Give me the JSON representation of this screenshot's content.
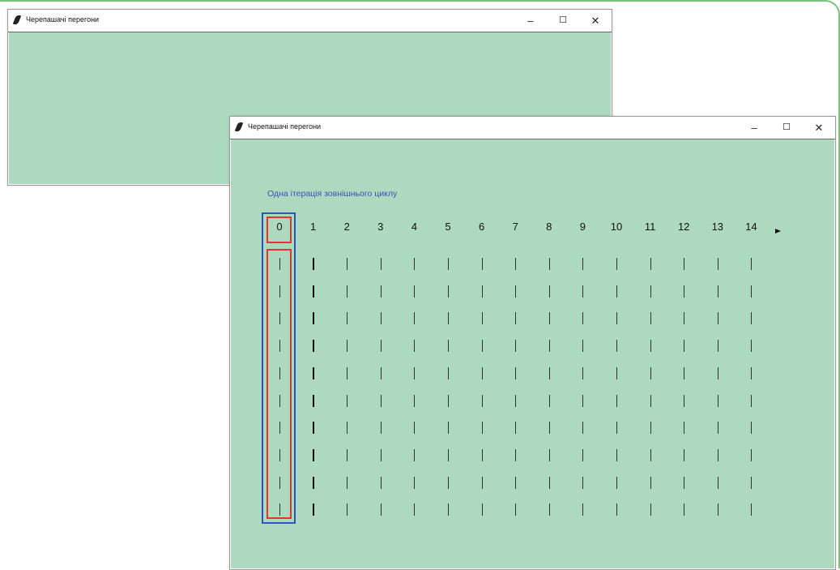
{
  "frame": {
    "accent": "#7cc37a"
  },
  "back_window": {
    "title": "Черепашачі перегони",
    "controls": {
      "minimize": "–",
      "maximize": "☐",
      "close": "✕"
    }
  },
  "front_window": {
    "title": "Черепашачі перегони",
    "controls": {
      "minimize": "–",
      "maximize": "☐",
      "close": "✕"
    },
    "canvas_color": "#add9bf",
    "caption": "Одна ітерація зовнішнього циклу",
    "track_numbers": [
      "0",
      "1",
      "2",
      "3",
      "4",
      "5",
      "6",
      "7",
      "8",
      "9",
      "10",
      "11",
      "12",
      "13",
      "14"
    ],
    "tick_rows": 10,
    "turtle_icon": "turtle-arrow-icon",
    "highlight_colors": {
      "outer_loop": "#2f56c8",
      "inner_item": "#e5352d"
    }
  }
}
